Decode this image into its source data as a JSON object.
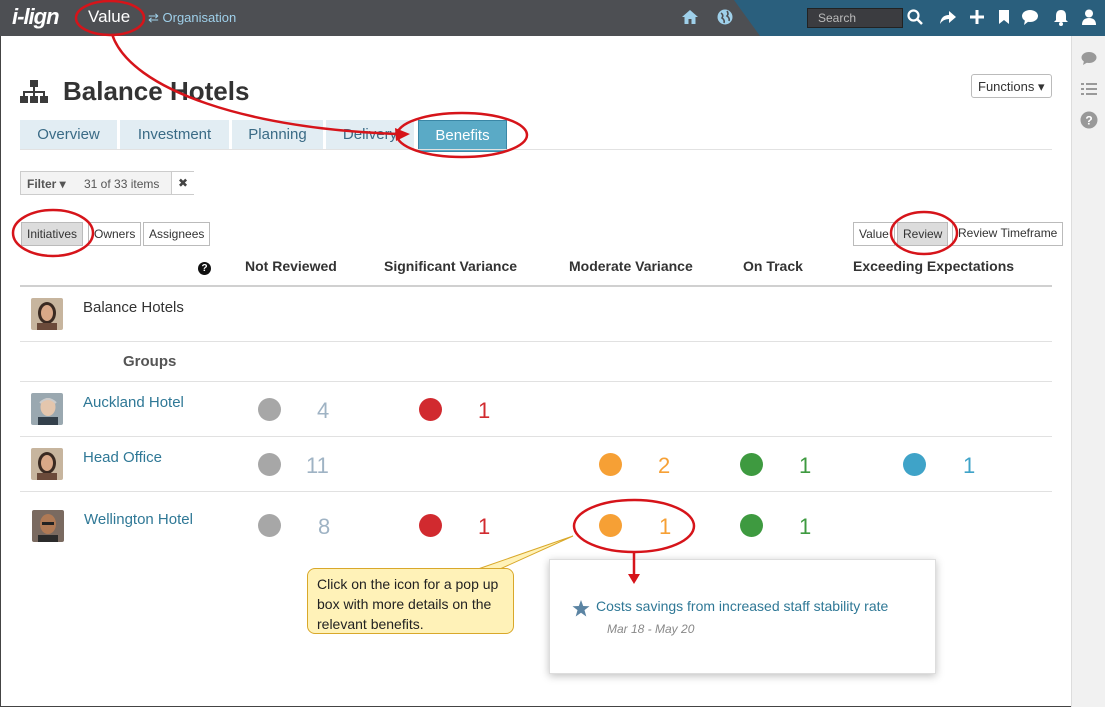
{
  "topbar": {
    "logo": "i-lign",
    "module": "Value",
    "org_link": "⇄ Organisation",
    "search_placeholder": "Search"
  },
  "page": {
    "title": "Balance Hotels",
    "functions_label": "Functions ▾"
  },
  "tabs": [
    "Overview",
    "Investment",
    "Planning",
    "Delivery",
    "Benefits"
  ],
  "active_tab": "Benefits",
  "filter": {
    "label": "Filter ▾",
    "count_text": "31 of 33 items",
    "clear_glyph": "✖"
  },
  "view_toggle": [
    "Initiatives",
    "Owners",
    "Assignees"
  ],
  "view_selected": "Initiatives",
  "mode_toggle": [
    "Value",
    "Review",
    "Review Timeframe"
  ],
  "mode_selected": "Review",
  "columns": [
    "Not Reviewed",
    "Significant Variance",
    "Moderate Variance",
    "On Track",
    "Exceeding Expectations"
  ],
  "colors": {
    "not_reviewed": "#a7a7a7",
    "significant": "#d12a2f",
    "moderate": "#f6a035",
    "on_track": "#3e9a40",
    "exceeding": "#3fa3c8",
    "count_grey": "#9fb3c4"
  },
  "rows": {
    "top": {
      "name": "Balance Hotels"
    },
    "groups_label": "Groups",
    "auckland": {
      "name": "Auckland Hotel",
      "not_reviewed": "4",
      "significant": "1"
    },
    "head_office": {
      "name": "Head Office",
      "not_reviewed": "11",
      "moderate": "2",
      "on_track": "1",
      "exceeding": "1"
    },
    "wellington": {
      "name": "Wellington Hotel",
      "not_reviewed": "8",
      "significant": "1",
      "moderate": "1",
      "on_track": "1"
    }
  },
  "callout": {
    "text": "Click on the icon for a pop up box with more details on the relevant benefits."
  },
  "popup": {
    "title": "Costs savings from increased staff stability rate",
    "dates": "Mar 18 - May 20"
  }
}
